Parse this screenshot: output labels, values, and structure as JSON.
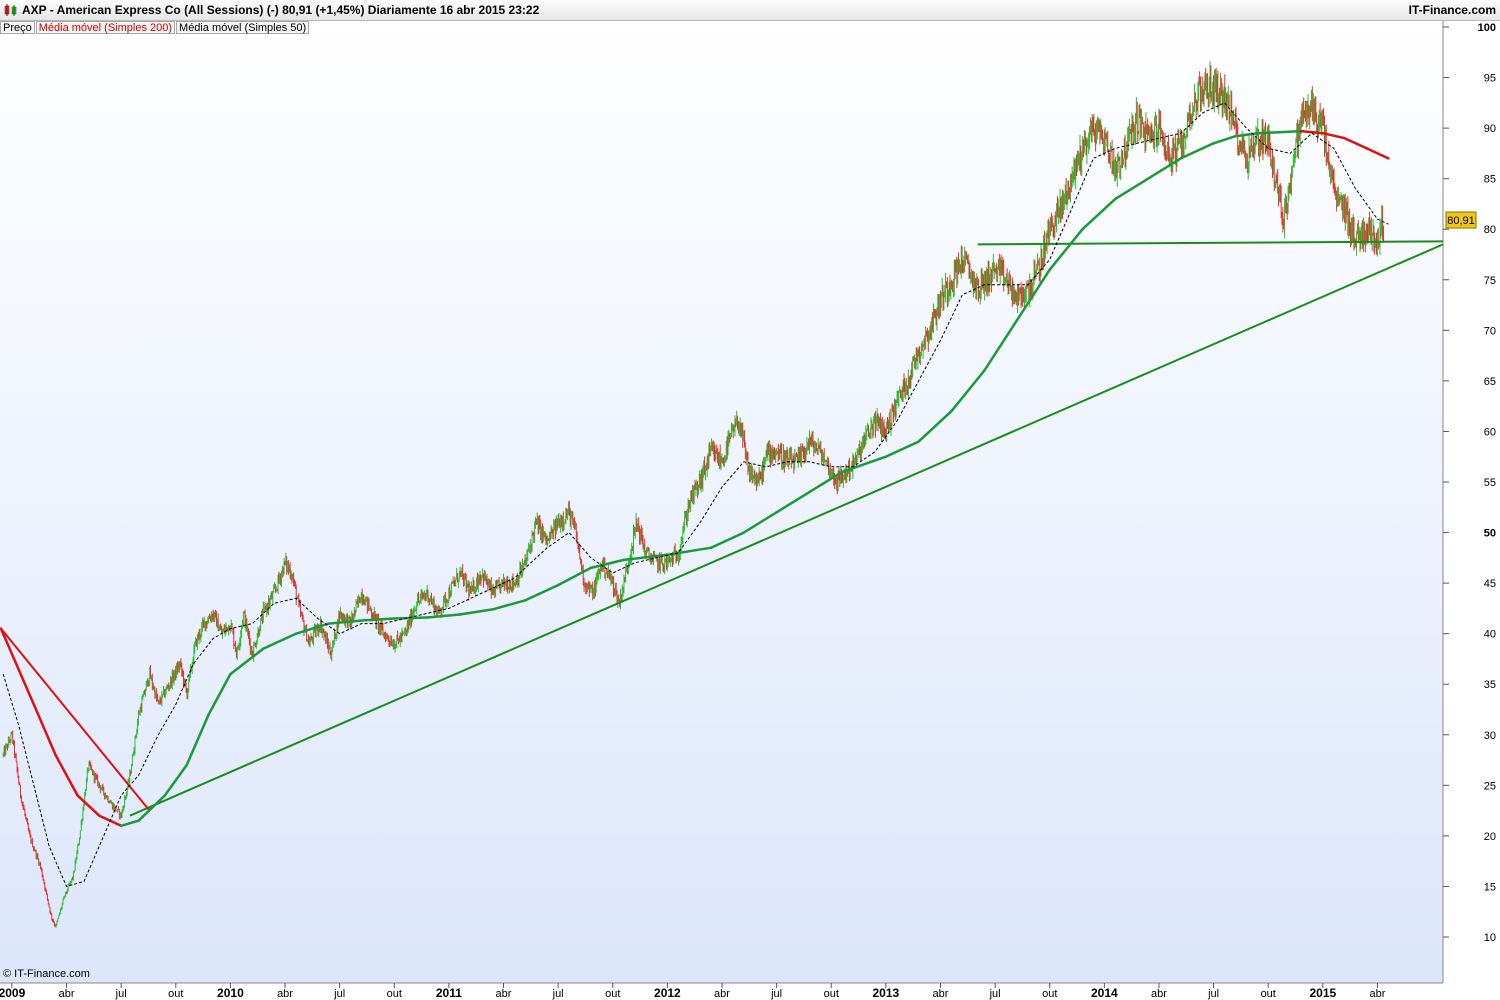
{
  "header": {
    "title": "AXP - American Express Co (All Sessions) (-)    80,91 (+1,45%)    Diariamente  16 abr 2015 23:22",
    "brand": "IT-Finance.com"
  },
  "legend": {
    "price": "Preço",
    "ma200": "Média móvel (Simples 200)",
    "ma50": "Média móvel (Simples 50)"
  },
  "footer": {
    "copyright": "© IT-Finance.com"
  },
  "colors": {
    "up": "#2eb82e",
    "down": "#e03030",
    "ma200": "#1a9a3a",
    "ma200_down": "#dd1111",
    "ma50": "#000000",
    "trend_green": "#1a8c1a",
    "trend_red": "#dd1111",
    "bg_top": "#ffffff",
    "bg_bottom": "#dce6fb",
    "last_label_bg": "#f0c814"
  },
  "chart_data": {
    "type": "line",
    "y_axis": {
      "min": 10,
      "max": 100,
      "ticks": [
        10,
        15,
        20,
        25,
        30,
        35,
        40,
        45,
        50,
        55,
        60,
        65,
        70,
        75,
        80,
        85,
        90,
        95,
        100
      ],
      "side": "right"
    },
    "x_axis": {
      "ticks": [
        {
          "label": "2009",
          "t": 2009.0,
          "bold": true
        },
        {
          "label": "abr",
          "t": 2009.25
        },
        {
          "label": "jul",
          "t": 2009.5
        },
        {
          "label": "out",
          "t": 2009.75
        },
        {
          "label": "2010",
          "t": 2010.0,
          "bold": true
        },
        {
          "label": "abr",
          "t": 2010.25
        },
        {
          "label": "jul",
          "t": 2010.5
        },
        {
          "label": "out",
          "t": 2010.75
        },
        {
          "label": "2011",
          "t": 2011.0,
          "bold": true
        },
        {
          "label": "abr",
          "t": 2011.25
        },
        {
          "label": "jul",
          "t": 2011.5
        },
        {
          "label": "out",
          "t": 2011.75
        },
        {
          "label": "2012",
          "t": 2012.0,
          "bold": true
        },
        {
          "label": "abr",
          "t": 2012.25
        },
        {
          "label": "jul",
          "t": 2012.5
        },
        {
          "label": "out",
          "t": 2012.75
        },
        {
          "label": "2013",
          "t": 2013.0,
          "bold": true
        },
        {
          "label": "abr",
          "t": 2013.25
        },
        {
          "label": "jul",
          "t": 2013.5
        },
        {
          "label": "out",
          "t": 2013.75
        },
        {
          "label": "2014",
          "t": 2014.0,
          "bold": true
        },
        {
          "label": "abr",
          "t": 2014.25
        },
        {
          "label": "jul",
          "t": 2014.5
        },
        {
          "label": "out",
          "t": 2014.75
        },
        {
          "label": "2015",
          "t": 2015.0,
          "bold": true
        },
        {
          "label": "abr",
          "t": 2015.25
        }
      ]
    },
    "last_price": {
      "label": "80,91",
      "value": 80.91
    },
    "series": [
      {
        "name": "Preço",
        "style": "candles",
        "points": [
          [
            2008.96,
            28
          ],
          [
            2009.0,
            30
          ],
          [
            2009.04,
            24
          ],
          [
            2009.08,
            20
          ],
          [
            2009.13,
            17
          ],
          [
            2009.18,
            12
          ],
          [
            2009.2,
            11
          ],
          [
            2009.24,
            14
          ],
          [
            2009.28,
            16
          ],
          [
            2009.31,
            20
          ],
          [
            2009.35,
            27
          ],
          [
            2009.4,
            25
          ],
          [
            2009.46,
            23
          ],
          [
            2009.5,
            22
          ],
          [
            2009.54,
            26
          ],
          [
            2009.58,
            32
          ],
          [
            2009.63,
            36
          ],
          [
            2009.67,
            33
          ],
          [
            2009.72,
            35
          ],
          [
            2009.77,
            37
          ],
          [
            2009.8,
            34
          ],
          [
            2009.84,
            39
          ],
          [
            2009.88,
            41
          ],
          [
            2009.92,
            42
          ],
          [
            2009.96,
            40
          ],
          [
            2010.0,
            41
          ],
          [
            2010.03,
            38
          ],
          [
            2010.06,
            42
          ],
          [
            2010.1,
            38
          ],
          [
            2010.15,
            42
          ],
          [
            2010.2,
            44
          ],
          [
            2010.25,
            47
          ],
          [
            2010.28,
            46
          ],
          [
            2010.32,
            42
          ],
          [
            2010.36,
            39
          ],
          [
            2010.41,
            41
          ],
          [
            2010.46,
            38
          ],
          [
            2010.5,
            42
          ],
          [
            2010.55,
            41
          ],
          [
            2010.6,
            44
          ],
          [
            2010.65,
            42
          ],
          [
            2010.7,
            40
          ],
          [
            2010.75,
            39
          ],
          [
            2010.8,
            40
          ],
          [
            2010.85,
            43
          ],
          [
            2010.9,
            44
          ],
          [
            2010.95,
            42
          ],
          [
            2011.0,
            44
          ],
          [
            2011.05,
            46
          ],
          [
            2011.1,
            44
          ],
          [
            2011.15,
            46
          ],
          [
            2011.2,
            44
          ],
          [
            2011.25,
            45
          ],
          [
            2011.3,
            45
          ],
          [
            2011.35,
            47
          ],
          [
            2011.4,
            51
          ],
          [
            2011.45,
            49
          ],
          [
            2011.5,
            51
          ],
          [
            2011.55,
            52
          ],
          [
            2011.58,
            50
          ],
          [
            2011.62,
            45
          ],
          [
            2011.66,
            44
          ],
          [
            2011.7,
            47
          ],
          [
            2011.75,
            45
          ],
          [
            2011.78,
            43
          ],
          [
            2011.82,
            47
          ],
          [
            2011.86,
            51
          ],
          [
            2011.9,
            48
          ],
          [
            2011.95,
            47
          ],
          [
            2012.0,
            47
          ],
          [
            2012.05,
            48
          ],
          [
            2012.1,
            53
          ],
          [
            2012.15,
            55
          ],
          [
            2012.2,
            58
          ],
          [
            2012.25,
            57
          ],
          [
            2012.3,
            60
          ],
          [
            2012.33,
            61
          ],
          [
            2012.37,
            56
          ],
          [
            2012.42,
            55
          ],
          [
            2012.46,
            58
          ],
          [
            2012.5,
            58
          ],
          [
            2012.55,
            57
          ],
          [
            2012.6,
            57
          ],
          [
            2012.65,
            59
          ],
          [
            2012.7,
            58
          ],
          [
            2012.75,
            56
          ],
          [
            2012.78,
            55
          ],
          [
            2012.82,
            56
          ],
          [
            2012.86,
            57
          ],
          [
            2012.9,
            59
          ],
          [
            2012.95,
            61
          ],
          [
            2013.0,
            60
          ],
          [
            2013.05,
            63
          ],
          [
            2013.1,
            65
          ],
          [
            2013.15,
            68
          ],
          [
            2013.2,
            70
          ],
          [
            2013.25,
            73
          ],
          [
            2013.3,
            75
          ],
          [
            2013.35,
            77
          ],
          [
            2013.38,
            76
          ],
          [
            2013.42,
            74
          ],
          [
            2013.46,
            75
          ],
          [
            2013.5,
            76
          ],
          [
            2013.55,
            75
          ],
          [
            2013.6,
            73
          ],
          [
            2013.65,
            74
          ],
          [
            2013.7,
            76
          ],
          [
            2013.75,
            80
          ],
          [
            2013.8,
            82
          ],
          [
            2013.85,
            85
          ],
          [
            2013.9,
            88
          ],
          [
            2013.95,
            90
          ],
          [
            2014.0,
            89
          ],
          [
            2014.05,
            86
          ],
          [
            2014.1,
            88
          ],
          [
            2014.15,
            91
          ],
          [
            2014.2,
            89
          ],
          [
            2014.25,
            90
          ],
          [
            2014.3,
            87
          ],
          [
            2014.35,
            88
          ],
          [
            2014.4,
            92
          ],
          [
            2014.45,
            94
          ],
          [
            2014.5,
            94
          ],
          [
            2014.55,
            93
          ],
          [
            2014.6,
            90
          ],
          [
            2014.65,
            87
          ],
          [
            2014.7,
            89
          ],
          [
            2014.75,
            89
          ],
          [
            2014.78,
            85
          ],
          [
            2014.82,
            81
          ],
          [
            2014.86,
            86
          ],
          [
            2014.9,
            91
          ],
          [
            2014.95,
            92
          ],
          [
            2015.0,
            90
          ],
          [
            2015.03,
            86
          ],
          [
            2015.06,
            83
          ],
          [
            2015.1,
            82
          ],
          [
            2015.15,
            79
          ],
          [
            2015.2,
            80
          ],
          [
            2015.25,
            79
          ],
          [
            2015.28,
            80.91
          ]
        ]
      },
      {
        "name": "Média móvel (Simples 200)",
        "style": "line",
        "points": [
          [
            2008.95,
            40.5
          ],
          [
            2009.0,
            38
          ],
          [
            2009.1,
            33
          ],
          [
            2009.2,
            28
          ],
          [
            2009.3,
            24
          ],
          [
            2009.4,
            22
          ],
          [
            2009.5,
            21
          ],
          [
            2009.58,
            21.5
          ],
          [
            2009.7,
            24
          ],
          [
            2009.8,
            27
          ],
          [
            2009.9,
            32
          ],
          [
            2010.0,
            36
          ],
          [
            2010.15,
            38.5
          ],
          [
            2010.3,
            40
          ],
          [
            2010.45,
            41
          ],
          [
            2010.6,
            41.3
          ],
          [
            2010.75,
            41.5
          ],
          [
            2010.9,
            41.6
          ],
          [
            2011.05,
            41.9
          ],
          [
            2011.2,
            42.4
          ],
          [
            2011.35,
            43.3
          ],
          [
            2011.5,
            44.8
          ],
          [
            2011.65,
            46.5
          ],
          [
            2011.8,
            47.3
          ],
          [
            2012.0,
            47.8
          ],
          [
            2012.2,
            48.5
          ],
          [
            2012.35,
            50
          ],
          [
            2012.5,
            52
          ],
          [
            2012.65,
            54
          ],
          [
            2012.8,
            56
          ],
          [
            2013.0,
            57.5
          ],
          [
            2013.15,
            59
          ],
          [
            2013.3,
            62
          ],
          [
            2013.45,
            66
          ],
          [
            2013.6,
            71
          ],
          [
            2013.75,
            76
          ],
          [
            2013.9,
            80
          ],
          [
            2014.05,
            83
          ],
          [
            2014.2,
            85
          ],
          [
            2014.35,
            87
          ],
          [
            2014.5,
            88.5
          ],
          [
            2014.6,
            89.2
          ],
          [
            2014.7,
            89.5
          ],
          [
            2014.8,
            89.6
          ],
          [
            2014.9,
            89.7
          ],
          [
            2015.0,
            89.5
          ],
          [
            2015.1,
            89.0
          ],
          [
            2015.2,
            88.0
          ],
          [
            2015.3,
            87.0
          ]
        ]
      },
      {
        "name": "Média móvel (Simples 50)",
        "style": "dashed",
        "points": [
          [
            2008.96,
            36
          ],
          [
            2009.03,
            31
          ],
          [
            2009.1,
            25
          ],
          [
            2009.17,
            19
          ],
          [
            2009.25,
            15
          ],
          [
            2009.33,
            15.5
          ],
          [
            2009.42,
            20
          ],
          [
            2009.5,
            24
          ],
          [
            2009.58,
            26
          ],
          [
            2009.67,
            30
          ],
          [
            2009.75,
            33
          ],
          [
            2009.83,
            37
          ],
          [
            2009.92,
            39.5
          ],
          [
            2010.0,
            40.5
          ],
          [
            2010.1,
            41
          ],
          [
            2010.2,
            43
          ],
          [
            2010.3,
            43.5
          ],
          [
            2010.4,
            41.5
          ],
          [
            2010.5,
            40
          ],
          [
            2010.6,
            41
          ],
          [
            2010.7,
            41
          ],
          [
            2010.8,
            41.5
          ],
          [
            2010.9,
            42
          ],
          [
            2011.0,
            42.5
          ],
          [
            2011.15,
            44
          ],
          [
            2011.3,
            45.5
          ],
          [
            2011.45,
            48.5
          ],
          [
            2011.55,
            50
          ],
          [
            2011.65,
            47.5
          ],
          [
            2011.75,
            46
          ],
          [
            2011.85,
            47
          ],
          [
            2011.95,
            47.5
          ],
          [
            2012.05,
            48
          ],
          [
            2012.15,
            51
          ],
          [
            2012.25,
            54.5
          ],
          [
            2012.35,
            57
          ],
          [
            2012.45,
            56.5
          ],
          [
            2012.55,
            57
          ],
          [
            2012.65,
            57
          ],
          [
            2012.75,
            56.5
          ],
          [
            2012.85,
            56.5
          ],
          [
            2012.95,
            58
          ],
          [
            2013.05,
            61
          ],
          [
            2013.15,
            65
          ],
          [
            2013.25,
            69
          ],
          [
            2013.35,
            73.5
          ],
          [
            2013.45,
            74.5
          ],
          [
            2013.55,
            74.5
          ],
          [
            2013.65,
            74.5
          ],
          [
            2013.75,
            77
          ],
          [
            2013.85,
            82
          ],
          [
            2013.95,
            87
          ],
          [
            2014.05,
            88
          ],
          [
            2014.15,
            88.5
          ],
          [
            2014.25,
            89
          ],
          [
            2014.35,
            89.5
          ],
          [
            2014.45,
            91.5
          ],
          [
            2014.55,
            92.5
          ],
          [
            2014.65,
            90
          ],
          [
            2014.75,
            88
          ],
          [
            2014.85,
            87.5
          ],
          [
            2014.95,
            89.5
          ],
          [
            2015.05,
            88
          ],
          [
            2015.15,
            84
          ],
          [
            2015.25,
            81
          ],
          [
            2015.3,
            80.5
          ]
        ]
      }
    ],
    "trendlines": [
      {
        "color": "trend_green",
        "from": [
          2009.54,
          22
        ],
        "to": [
          2015.55,
          78.5
        ]
      },
      {
        "color": "trend_green",
        "from": [
          2013.42,
          78.5
        ],
        "to": [
          2015.55,
          78.8
        ]
      },
      {
        "color": "trend_red",
        "from": [
          2008.95,
          40.5
        ],
        "to": [
          2009.63,
          22.5
        ]
      }
    ]
  }
}
